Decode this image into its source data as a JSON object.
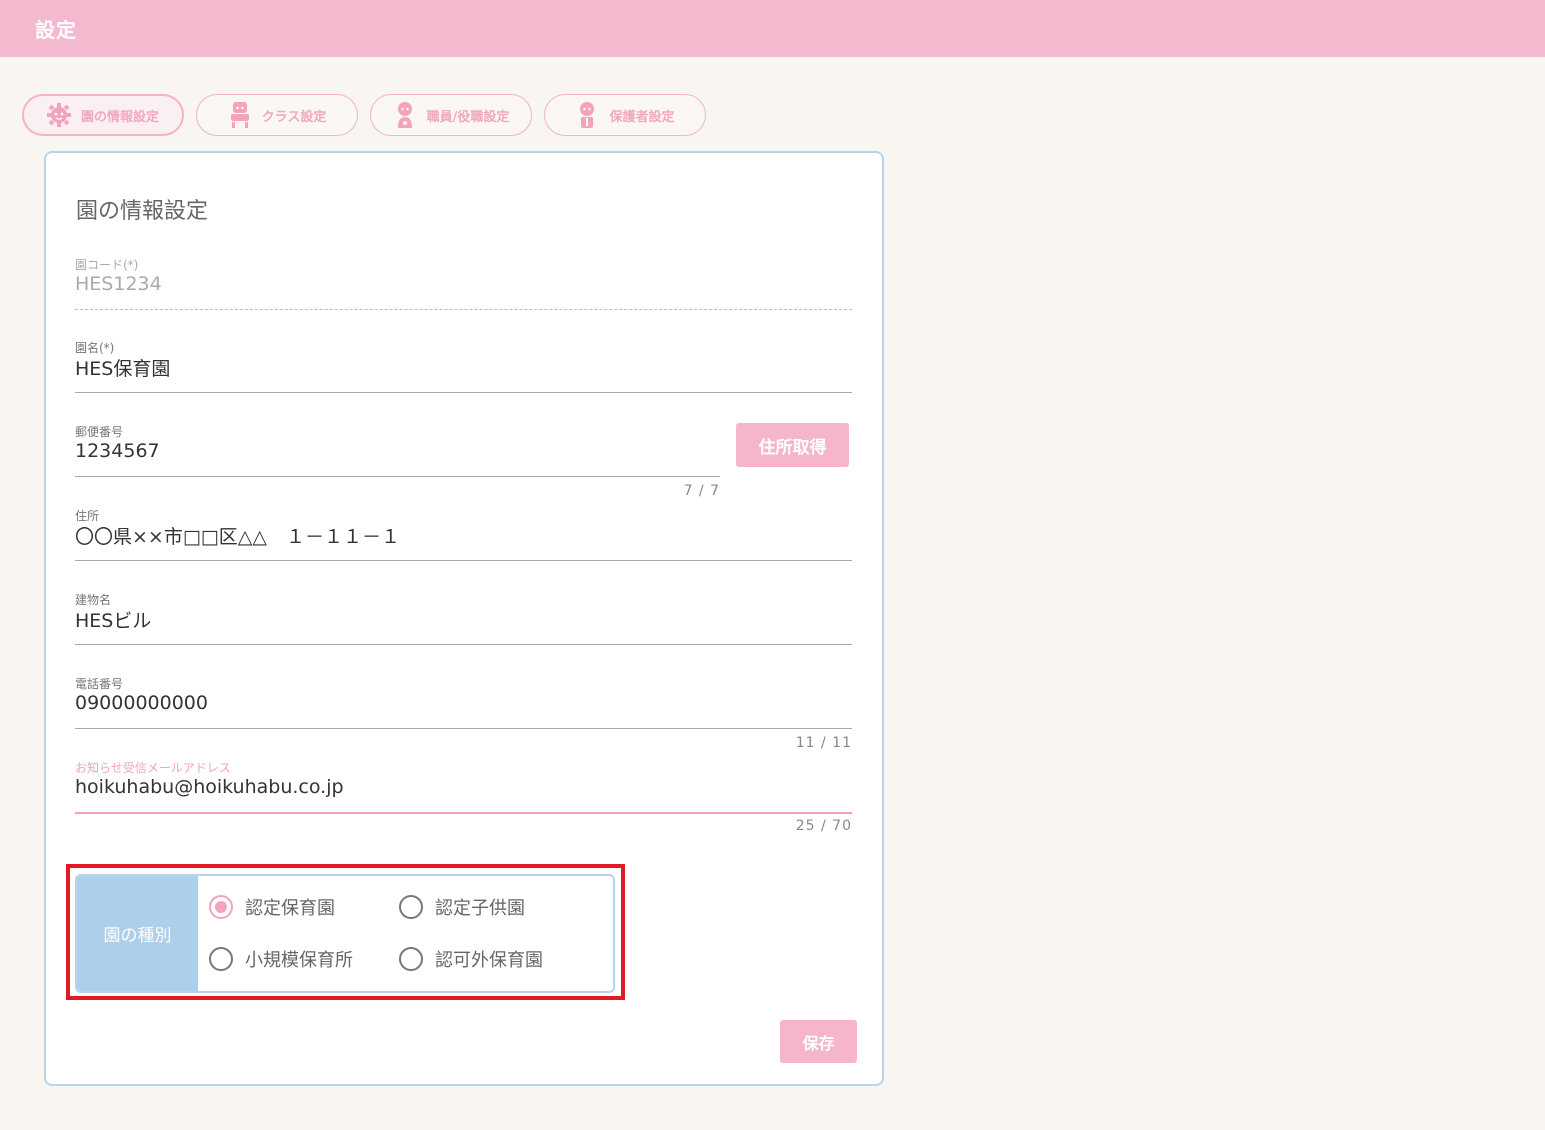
{
  "header": {
    "title": "設定"
  },
  "tabs": [
    {
      "label": "園の情報設定",
      "icon": "gear-icon",
      "active": true
    },
    {
      "label": "クラス設定",
      "icon": "teacher-icon",
      "active": false
    },
    {
      "label": "職員/役職設定",
      "icon": "staff-icon",
      "active": false
    },
    {
      "label": "保護者設定",
      "icon": "parent-icon",
      "active": false
    }
  ],
  "card": {
    "title": "園の情報設定",
    "fields": {
      "code": {
        "label": "園コード(*)",
        "value": "HES1234"
      },
      "name": {
        "label": "園名(*)",
        "value": "HES保育園"
      },
      "postal": {
        "label": "郵便番号",
        "value": "1234567",
        "counter": "7 / 7",
        "button": "住所取得"
      },
      "address": {
        "label": "住所",
        "value": "〇〇県××市□□区△△　１－１１－１"
      },
      "building": {
        "label": "建物名",
        "value": "HESビル"
      },
      "phone": {
        "label": "電話番号",
        "value": "09000000000",
        "counter": "11 / 11"
      },
      "email": {
        "label": "お知らせ受信メールアドレス",
        "value": "hoikuhabu@hoikuhabu.co.jp",
        "counter": "25 / 70"
      }
    },
    "school_type": {
      "label": "園の種別",
      "options": [
        "認定保育園",
        "認定子供園",
        "小規模保育所",
        "認可外保育園"
      ],
      "selected": "認定保育園"
    },
    "save_label": "保存"
  },
  "colors": {
    "header": "#f4b9ce",
    "accent_pink": "#f4a3bc",
    "card_border": "#b7d5ea",
    "type_label_bg": "#aecfe9",
    "highlight": "#e11a24",
    "page_bg": "#f9f5f1"
  }
}
